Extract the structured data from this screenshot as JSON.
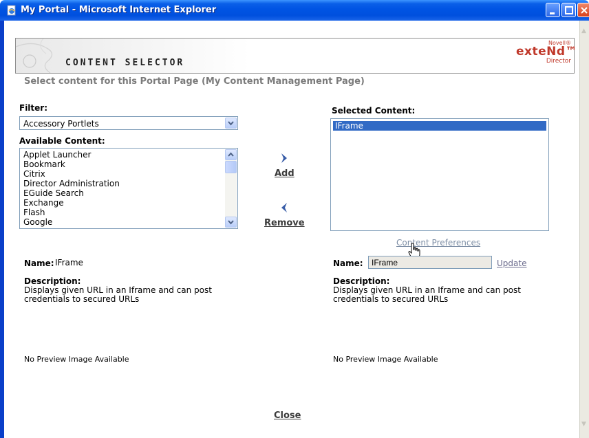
{
  "window": {
    "title": "My Portal - Microsoft Internet Explorer",
    "icons": [
      "ie-page-icon",
      "minimize-icon",
      "maximize-icon",
      "close-icon"
    ]
  },
  "banner": {
    "title": "CONTENT SELECTOR",
    "brand_top": "Novell®",
    "brand_name": "exteNd™",
    "brand_sub": "Director"
  },
  "subtitle": "Select content for this Portal Page (My Content Management Page)",
  "filter": {
    "label": "Filter:",
    "selected": "Accessory Portlets"
  },
  "available": {
    "label": "Available Content:",
    "items": [
      "Applet Launcher",
      "Bookmark",
      "Citrix",
      "Director Administration",
      "EGuide Search",
      "Exchange",
      "Flash",
      "Google"
    ]
  },
  "selected": {
    "label": "Selected Content:",
    "items": [
      "IFrame"
    ]
  },
  "actions": {
    "add": "Add",
    "remove": "Remove",
    "content_preferences": "Content Preferences",
    "update": "Update",
    "close": "Close"
  },
  "left_detail": {
    "name_label": "Name:",
    "name_value": "IFrame",
    "description_label": "Description:",
    "description_line1": "Displays given URL in an Iframe and can post",
    "description_line2": "credentials to secured URLs",
    "preview": "No Preview Image Available"
  },
  "right_detail": {
    "name_label": "Name:",
    "name_value": "IFrame",
    "description_label": "Description:",
    "description_line1": "Displays given URL in an Iframe and can post",
    "description_line2": "credentials to secured URLs",
    "preview": "No Preview Image Available"
  },
  "colors": {
    "titlebar": "#0054e3",
    "selection": "#316ac5",
    "brand": "#c0392b"
  }
}
